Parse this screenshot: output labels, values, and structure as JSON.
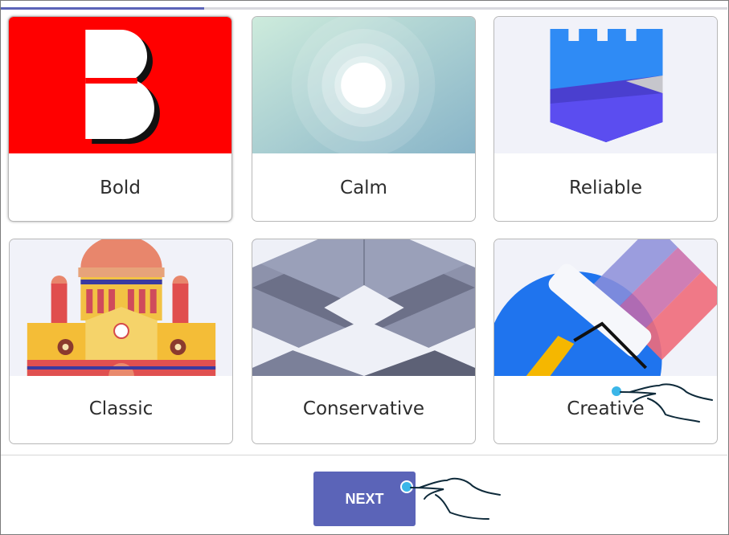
{
  "progress": {
    "value": 0.28,
    "color": "#5b64b8"
  },
  "styles": [
    {
      "label": "Bold",
      "icon": "bold-b-icon"
    },
    {
      "label": "Calm",
      "icon": "calm-circles-icon"
    },
    {
      "label": "Reliable",
      "icon": "castle-shield-icon"
    },
    {
      "label": "Classic",
      "icon": "classic-building-icon"
    },
    {
      "label": "Conservative",
      "icon": "conservative-pattern-icon"
    },
    {
      "label": "Creative",
      "icon": "paint-roller-icon"
    }
  ],
  "selected_style": "Bold",
  "next_button": {
    "label": "NEXT",
    "color": "#5b64b8"
  },
  "pointer_hints": [
    "hand-pointer-icon"
  ]
}
